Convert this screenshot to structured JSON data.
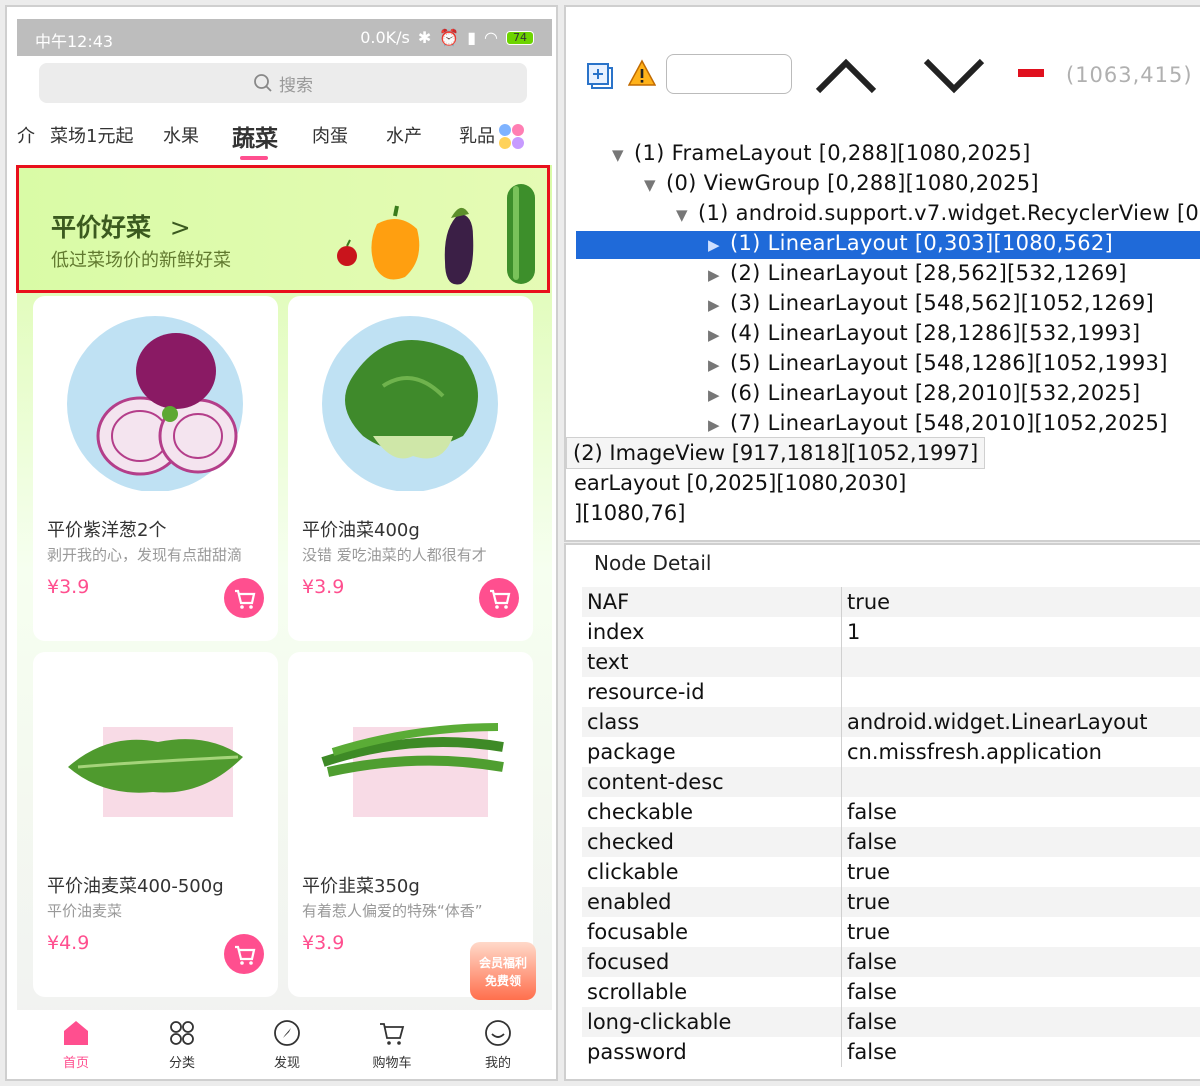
{
  "phone": {
    "status_bar": {
      "time": "中午12:43",
      "network_speed": "0.0K/s",
      "battery": "74"
    },
    "search": {
      "placeholder": "搜索"
    },
    "tabs": [
      {
        "label": "介"
      },
      {
        "label": "菜场1元起"
      },
      {
        "label": "水果"
      },
      {
        "label": "蔬菜",
        "active": true
      },
      {
        "label": "肉蛋"
      },
      {
        "label": "水产"
      },
      {
        "label": "乳品"
      }
    ],
    "banner": {
      "title": "平价好菜",
      "chevron": ">",
      "subtitle": "低过菜场价的新鲜好菜"
    },
    "products": [
      {
        "name": "平价紫洋葱2个",
        "desc": "剥开我的心，发现有点甜甜滴",
        "price": "¥3.9",
        "icon": "red-onion"
      },
      {
        "name": "平价油菜400g",
        "desc": "没错 爱吃油菜的人都很有才",
        "price": "¥3.9",
        "icon": "bok-choy"
      },
      {
        "name": "平价油麦菜400-500g",
        "desc": "平价油麦菜",
        "price": "¥4.9",
        "icon": "lettuce"
      },
      {
        "name": "平价韭菜350g",
        "desc": "有着惹人偏爱的特殊“体香”",
        "price": "¥3.9",
        "icon": "chives"
      }
    ],
    "member_badge": {
      "line1": "会员福利",
      "line2": "免费领"
    },
    "bottom_nav": [
      {
        "label": "首页",
        "icon": "home-icon",
        "active": true
      },
      {
        "label": "分类",
        "icon": "grid-icon"
      },
      {
        "label": "发现",
        "icon": "compass-icon"
      },
      {
        "label": "购物车",
        "icon": "cart-icon"
      },
      {
        "label": "我的",
        "icon": "smile-icon"
      }
    ],
    "accent_color": "#ff4f8f"
  },
  "inspector": {
    "coords": "(1063,415)",
    "tree": [
      {
        "label": "(1) FrameLayout [0,288][1080,2025]",
        "expanded": true
      },
      {
        "label": "(0) ViewGroup [0,288][1080,2025]",
        "expanded": true
      },
      {
        "label": "(1) android.support.v7.widget.RecyclerView [0,2",
        "expanded": true
      },
      {
        "label": "(1) LinearLayout [0,303][1080,562]",
        "selected": true
      },
      {
        "label": "(2) LinearLayout [28,562][532,1269]"
      },
      {
        "label": "(3) LinearLayout [548,562][1052,1269]"
      },
      {
        "label": "(4) LinearLayout [28,1286][532,1993]"
      },
      {
        "label": "(5) LinearLayout [548,1286][1052,1993]"
      },
      {
        "label": "(6) LinearLayout [28,2010][532,2025]"
      },
      {
        "label": "(7) LinearLayout [548,2010][1052,2025]"
      }
    ],
    "tooltip": "(2) ImageView [917,1818][1052,1997]",
    "tail_1": "earLayout [0,2025][1080,2030]",
    "tail_2": "][1080,76]",
    "selection_color": "#1f6ad9"
  },
  "detail": {
    "header": "Node Detail",
    "rows": [
      {
        "key": "NAF",
        "value": "true"
      },
      {
        "key": "index",
        "value": "1"
      },
      {
        "key": "text",
        "value": ""
      },
      {
        "key": "resource-id",
        "value": ""
      },
      {
        "key": "class",
        "value": "android.widget.LinearLayout"
      },
      {
        "key": "package",
        "value": "cn.missfresh.application"
      },
      {
        "key": "content-desc",
        "value": ""
      },
      {
        "key": "checkable",
        "value": "false"
      },
      {
        "key": "checked",
        "value": "false"
      },
      {
        "key": "clickable",
        "value": "true"
      },
      {
        "key": "enabled",
        "value": "true"
      },
      {
        "key": "focusable",
        "value": "true"
      },
      {
        "key": "focused",
        "value": "false"
      },
      {
        "key": "scrollable",
        "value": "false"
      },
      {
        "key": "long-clickable",
        "value": "false"
      },
      {
        "key": "password",
        "value": "false"
      }
    ]
  }
}
